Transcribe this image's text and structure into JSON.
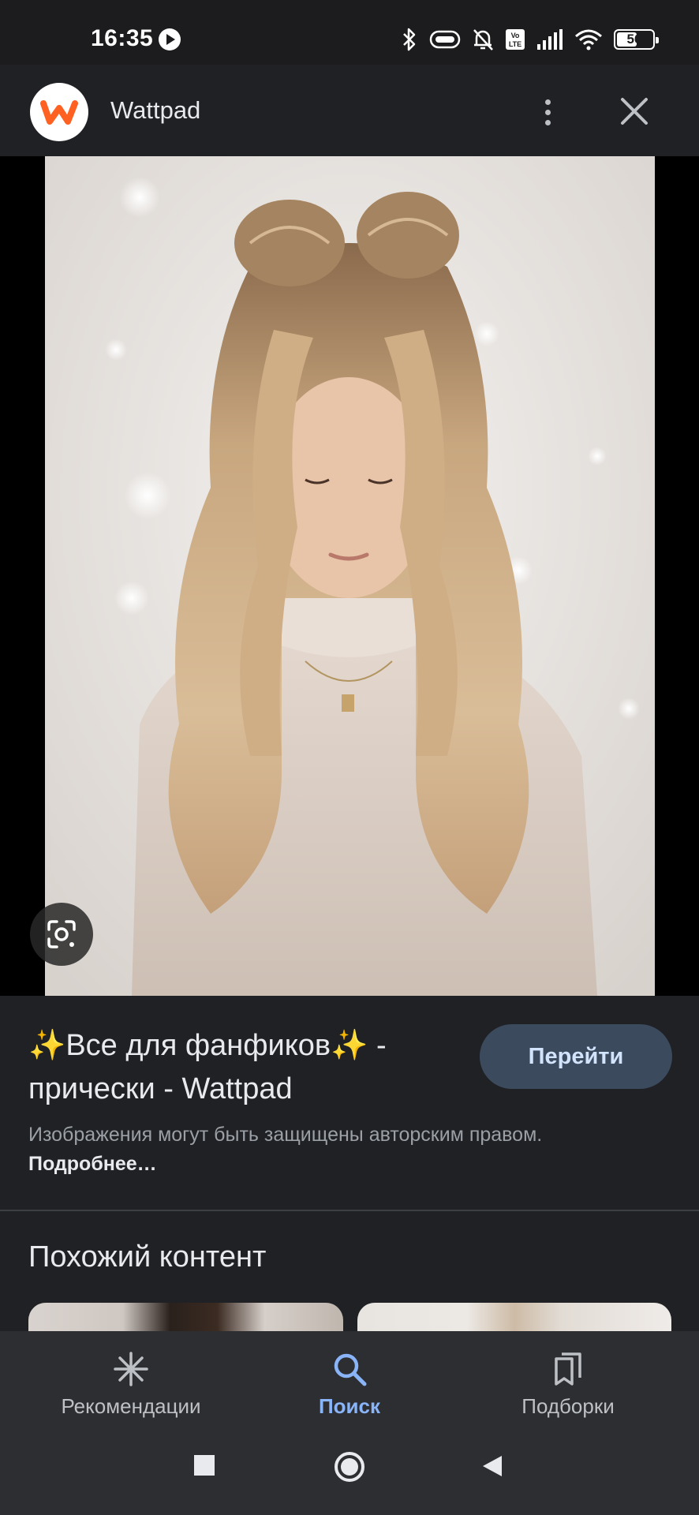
{
  "status_bar": {
    "time": "16:35",
    "battery_level": "56",
    "battery_fraction": 0.56,
    "icons": [
      "play-icon",
      "bluetooth-icon",
      "vibrate-icon",
      "bell-off-icon",
      "volte-icon",
      "signal-icon",
      "wifi-icon",
      "battery-icon"
    ]
  },
  "header": {
    "site_name": "Wattpad",
    "logo_icon": "wattpad-logo",
    "menu_icon": "more-vert-icon",
    "close_icon": "close-icon"
  },
  "viewer": {
    "lens_icon": "google-lens-icon"
  },
  "info": {
    "title": "✨Все для фанфиков✨ - прически - Wattpad",
    "go_button": "Перейти",
    "copyright_text": "Изображения могут быть защищены авторским правом.",
    "learn_more": "Подробнее…"
  },
  "similar": {
    "title": "Похожий контент"
  },
  "bottom_nav": {
    "items": [
      {
        "label": "Рекомендации",
        "icon": "asterisk-icon",
        "active": false
      },
      {
        "label": "Поиск",
        "icon": "search-icon",
        "active": true
      },
      {
        "label": "Подборки",
        "icon": "collections-icon",
        "active": false
      }
    ]
  },
  "colors": {
    "background": "#202124",
    "accent": "#8ab4f8",
    "button_bg": "#3c4a5e",
    "wattpad_orange": "#ff6122"
  }
}
